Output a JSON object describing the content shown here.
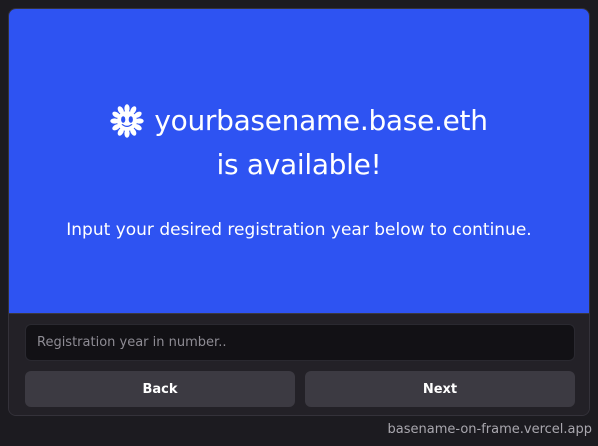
{
  "hero": {
    "icon": "base-flower-logo-icon",
    "title": "yourbasename.base.eth",
    "subtitle": "is available!",
    "description": "Input your desired registration year below to continue.",
    "background_color": "#2e53f2"
  },
  "form": {
    "input_placeholder": "Registration year in number..",
    "input_value": ""
  },
  "buttons": {
    "back_label": "Back",
    "next_label": "Next"
  },
  "footer": {
    "url": "basename-on-frame.vercel.app"
  }
}
